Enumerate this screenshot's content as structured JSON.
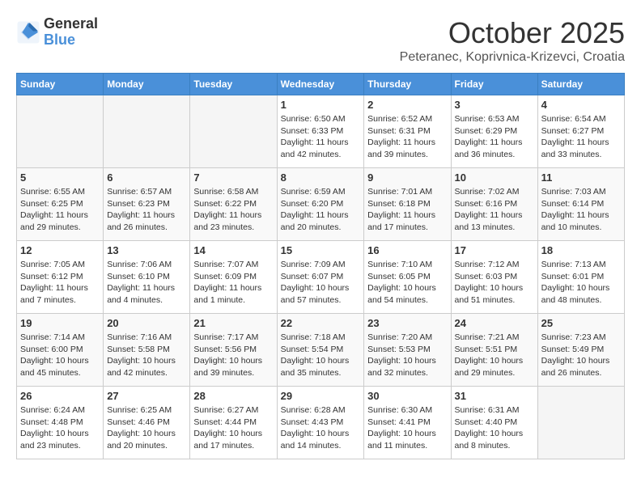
{
  "header": {
    "logo_line1": "General",
    "logo_line2": "Blue",
    "month": "October 2025",
    "location": "Peteranec, Koprivnica-Krizevci, Croatia"
  },
  "days_of_week": [
    "Sunday",
    "Monday",
    "Tuesday",
    "Wednesday",
    "Thursday",
    "Friday",
    "Saturday"
  ],
  "weeks": [
    [
      {
        "day": "",
        "info": ""
      },
      {
        "day": "",
        "info": ""
      },
      {
        "day": "",
        "info": ""
      },
      {
        "day": "1",
        "info": "Sunrise: 6:50 AM\nSunset: 6:33 PM\nDaylight: 11 hours\nand 42 minutes."
      },
      {
        "day": "2",
        "info": "Sunrise: 6:52 AM\nSunset: 6:31 PM\nDaylight: 11 hours\nand 39 minutes."
      },
      {
        "day": "3",
        "info": "Sunrise: 6:53 AM\nSunset: 6:29 PM\nDaylight: 11 hours\nand 36 minutes."
      },
      {
        "day": "4",
        "info": "Sunrise: 6:54 AM\nSunset: 6:27 PM\nDaylight: 11 hours\nand 33 minutes."
      }
    ],
    [
      {
        "day": "5",
        "info": "Sunrise: 6:55 AM\nSunset: 6:25 PM\nDaylight: 11 hours\nand 29 minutes."
      },
      {
        "day": "6",
        "info": "Sunrise: 6:57 AM\nSunset: 6:23 PM\nDaylight: 11 hours\nand 26 minutes."
      },
      {
        "day": "7",
        "info": "Sunrise: 6:58 AM\nSunset: 6:22 PM\nDaylight: 11 hours\nand 23 minutes."
      },
      {
        "day": "8",
        "info": "Sunrise: 6:59 AM\nSunset: 6:20 PM\nDaylight: 11 hours\nand 20 minutes."
      },
      {
        "day": "9",
        "info": "Sunrise: 7:01 AM\nSunset: 6:18 PM\nDaylight: 11 hours\nand 17 minutes."
      },
      {
        "day": "10",
        "info": "Sunrise: 7:02 AM\nSunset: 6:16 PM\nDaylight: 11 hours\nand 13 minutes."
      },
      {
        "day": "11",
        "info": "Sunrise: 7:03 AM\nSunset: 6:14 PM\nDaylight: 11 hours\nand 10 minutes."
      }
    ],
    [
      {
        "day": "12",
        "info": "Sunrise: 7:05 AM\nSunset: 6:12 PM\nDaylight: 11 hours\nand 7 minutes."
      },
      {
        "day": "13",
        "info": "Sunrise: 7:06 AM\nSunset: 6:10 PM\nDaylight: 11 hours\nand 4 minutes."
      },
      {
        "day": "14",
        "info": "Sunrise: 7:07 AM\nSunset: 6:09 PM\nDaylight: 11 hours\nand 1 minute."
      },
      {
        "day": "15",
        "info": "Sunrise: 7:09 AM\nSunset: 6:07 PM\nDaylight: 10 hours\nand 57 minutes."
      },
      {
        "day": "16",
        "info": "Sunrise: 7:10 AM\nSunset: 6:05 PM\nDaylight: 10 hours\nand 54 minutes."
      },
      {
        "day": "17",
        "info": "Sunrise: 7:12 AM\nSunset: 6:03 PM\nDaylight: 10 hours\nand 51 minutes."
      },
      {
        "day": "18",
        "info": "Sunrise: 7:13 AM\nSunset: 6:01 PM\nDaylight: 10 hours\nand 48 minutes."
      }
    ],
    [
      {
        "day": "19",
        "info": "Sunrise: 7:14 AM\nSunset: 6:00 PM\nDaylight: 10 hours\nand 45 minutes."
      },
      {
        "day": "20",
        "info": "Sunrise: 7:16 AM\nSunset: 5:58 PM\nDaylight: 10 hours\nand 42 minutes."
      },
      {
        "day": "21",
        "info": "Sunrise: 7:17 AM\nSunset: 5:56 PM\nDaylight: 10 hours\nand 39 minutes."
      },
      {
        "day": "22",
        "info": "Sunrise: 7:18 AM\nSunset: 5:54 PM\nDaylight: 10 hours\nand 35 minutes."
      },
      {
        "day": "23",
        "info": "Sunrise: 7:20 AM\nSunset: 5:53 PM\nDaylight: 10 hours\nand 32 minutes."
      },
      {
        "day": "24",
        "info": "Sunrise: 7:21 AM\nSunset: 5:51 PM\nDaylight: 10 hours\nand 29 minutes."
      },
      {
        "day": "25",
        "info": "Sunrise: 7:23 AM\nSunset: 5:49 PM\nDaylight: 10 hours\nand 26 minutes."
      }
    ],
    [
      {
        "day": "26",
        "info": "Sunrise: 6:24 AM\nSunset: 4:48 PM\nDaylight: 10 hours\nand 23 minutes."
      },
      {
        "day": "27",
        "info": "Sunrise: 6:25 AM\nSunset: 4:46 PM\nDaylight: 10 hours\nand 20 minutes."
      },
      {
        "day": "28",
        "info": "Sunrise: 6:27 AM\nSunset: 4:44 PM\nDaylight: 10 hours\nand 17 minutes."
      },
      {
        "day": "29",
        "info": "Sunrise: 6:28 AM\nSunset: 4:43 PM\nDaylight: 10 hours\nand 14 minutes."
      },
      {
        "day": "30",
        "info": "Sunrise: 6:30 AM\nSunset: 4:41 PM\nDaylight: 10 hours\nand 11 minutes."
      },
      {
        "day": "31",
        "info": "Sunrise: 6:31 AM\nSunset: 4:40 PM\nDaylight: 10 hours\nand 8 minutes."
      },
      {
        "day": "",
        "info": ""
      }
    ]
  ]
}
